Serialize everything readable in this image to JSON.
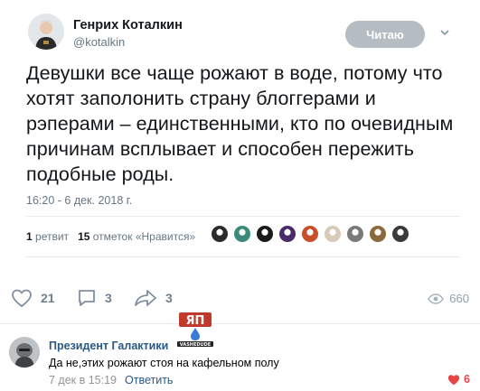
{
  "tweet": {
    "author_name": "Генрих Коталкин",
    "author_handle": "@kotalkin",
    "follow_button": "Читаю",
    "text": "Девушки все чаще рожают в воде, потому что хотят заполонить страну блоггерами и рэперами – единственными, кто по очевидным причинам всплывает и способен пережить подобные роды.",
    "timestamp": "16:20 - 6 дек. 2018 г.",
    "retweets_count": "1",
    "retweets_label": "ретвит",
    "likes_count": "15",
    "likes_label": "отметок «Нравится»",
    "liker_colors": [
      "#2b2b2b",
      "#3a8a7a",
      "#1a1a1a",
      "#4a2a6a",
      "#c94f2a",
      "#d8c9b8",
      "#7a7a7a",
      "#8a6a3a",
      "#3a3a3a"
    ]
  },
  "post_actions": {
    "likes": "21",
    "comments": "3",
    "shares": "3",
    "views": "660"
  },
  "watermark": {
    "top_text": "ЯП",
    "bottom_text": "VASHEDUDE"
  },
  "comment": {
    "author": "Президент Галактики",
    "text": "Да не,этих рожают стоя на кафельном полу",
    "date": "7 дек в 15:19",
    "reply": "Ответить",
    "likes": "6"
  },
  "colors": {
    "link": "#2a5885",
    "like_red": "#e64646",
    "icon_gray": "#6f7f90"
  }
}
